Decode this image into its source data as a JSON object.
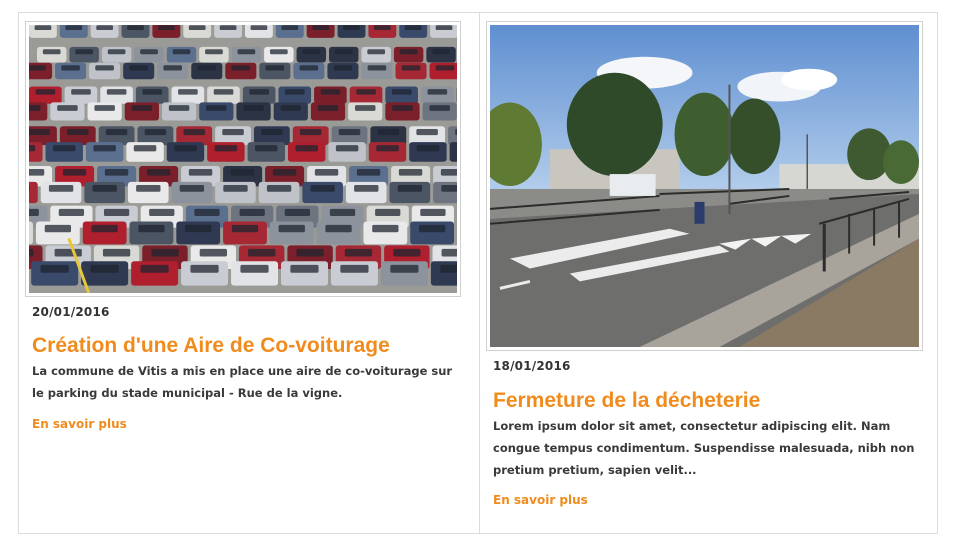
{
  "articles": [
    {
      "image": "parking-lot-photo",
      "date": "20/01/2016",
      "title": "Création d'une Aire de Co-voiturage",
      "excerpt": "La commune de Vitis a mis en place une aire de co-voiturage sur le parking du stade municipal - Rue de la vigne.",
      "more_label": "En savoir plus"
    },
    {
      "image": "waste-center-entrance-photo",
      "date": "18/01/2016",
      "title": "Fermeture de la décheterie",
      "excerpt": "Lorem ipsum dolor sit amet, consectetur adipiscing elit. Nam congue tempus condimentum. Suspendisse malesuada, nibh non pretium pretium, sapien velit...",
      "more_label": "En savoir plus"
    }
  ],
  "colors": {
    "accent": "#f08c1e",
    "text": "#3a3a3a",
    "border": "#dcdcdc"
  }
}
